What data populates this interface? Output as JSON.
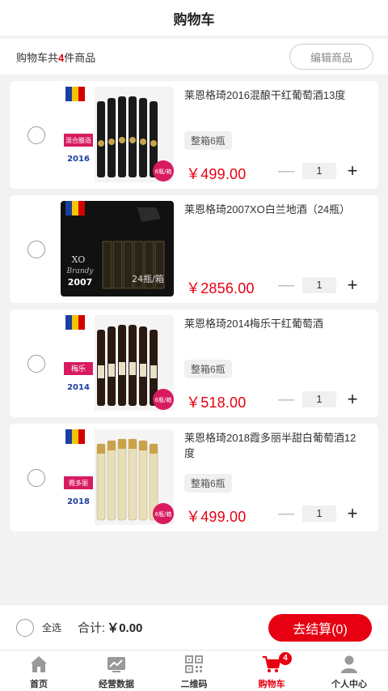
{
  "header": {
    "title": "购物车"
  },
  "summary": {
    "prefix": "购物车共",
    "count": "4",
    "suffix": "件商品",
    "edit_label": "编辑商品"
  },
  "items": [
    {
      "name": "莱恩格琦2016混酿干红葡萄酒13度",
      "tag": "整箱6瓶",
      "price": "￥499.00",
      "qty": "1",
      "minus": "—",
      "plus": "+"
    },
    {
      "name": "莱恩格琦2007XO白兰地酒（24瓶）",
      "tag": "",
      "price": "￥2856.00",
      "qty": "1",
      "minus": "—",
      "plus": "+"
    },
    {
      "name": "莱恩格琦2014梅乐干红葡萄酒",
      "tag": "整箱6瓶",
      "price": "￥518.00",
      "qty": "1",
      "minus": "—",
      "plus": "+"
    },
    {
      "name": "莱恩格琦2018霞多丽半甜白葡萄酒12度",
      "tag": "整箱6瓶",
      "price": "￥499.00",
      "qty": "1",
      "minus": "—",
      "plus": "+"
    }
  ],
  "product_images": [
    {
      "label": "混合酿造",
      "year": "2016",
      "badge": "6瓶/箱",
      "label_color": "#d81b60",
      "bottle_color": "#1a1a1a",
      "bg": "#f4f4f4"
    },
    {
      "label": "XO",
      "year": "2007",
      "badge": "24瓶/箱",
      "sub": "Brandy",
      "bg": "#111111"
    },
    {
      "label": "梅乐",
      "year": "2014",
      "badge": "6瓶/箱",
      "label_color": "#d81b60",
      "bottle_color": "#2a1a12",
      "bg": "#f4f4f4"
    },
    {
      "label": "霞多丽",
      "year": "2018",
      "badge": "6瓶/箱",
      "label_color": "#d81b60",
      "bottle_color": "#e8dfb8",
      "bg": "#f4f4f4"
    }
  ],
  "checkout": {
    "select_all": "全选",
    "total_label": "合计:",
    "total_value": "￥0.00",
    "button_label": "去结算(0)"
  },
  "tabs": [
    {
      "label": "首页",
      "icon": "home-icon"
    },
    {
      "label": "经营数据",
      "icon": "chart-icon"
    },
    {
      "label": "二维码",
      "icon": "qrcode-icon"
    },
    {
      "label": "购物车",
      "icon": "cart-icon",
      "badge": "4"
    },
    {
      "label": "个人中心",
      "icon": "user-icon"
    }
  ],
  "colors": {
    "accent": "#e60012",
    "tab_gray": "#999999"
  }
}
